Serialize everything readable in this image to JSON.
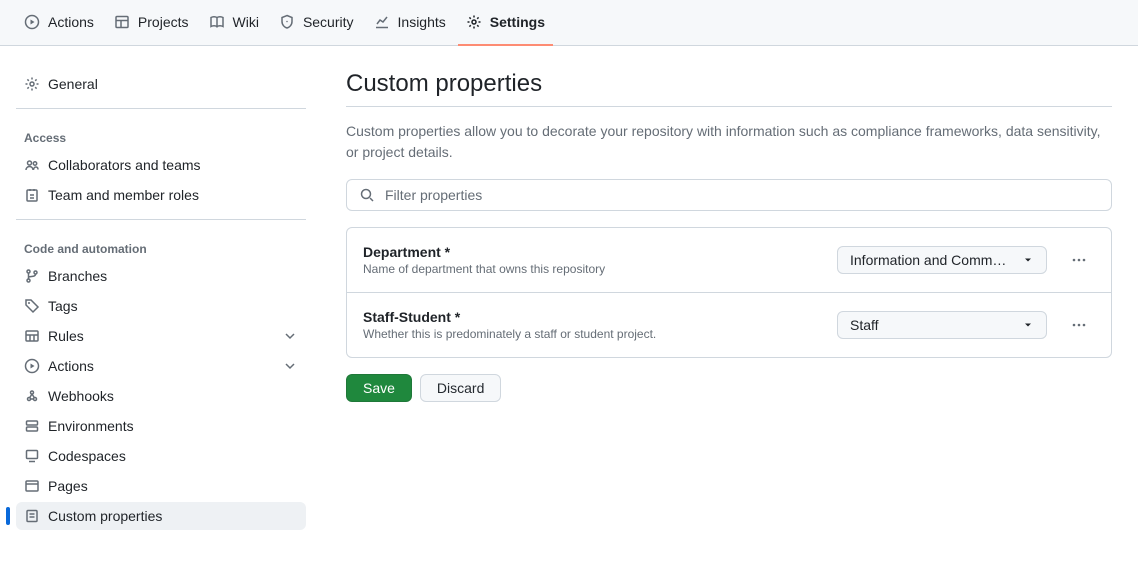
{
  "topnav": {
    "actions": "Actions",
    "projects": "Projects",
    "wiki": "Wiki",
    "security": "Security",
    "insights": "Insights",
    "settings": "Settings"
  },
  "sidebar": {
    "general": "General",
    "group_access": "Access",
    "collaborators": "Collaborators and teams",
    "team_roles": "Team and member roles",
    "group_code": "Code and automation",
    "branches": "Branches",
    "tags": "Tags",
    "rules": "Rules",
    "actions": "Actions",
    "webhooks": "Webhooks",
    "environments": "Environments",
    "codespaces": "Codespaces",
    "pages": "Pages",
    "custom_properties": "Custom properties"
  },
  "main": {
    "title": "Custom properties",
    "description": "Custom properties allow you to decorate your repository with information such as compliance frameworks, data sensitivity, or project details.",
    "search_placeholder": "Filter properties",
    "save": "Save",
    "discard": "Discard"
  },
  "properties": [
    {
      "label": "Department *",
      "sub": "Name of department that owns this repository",
      "value": "Information and Commu…"
    },
    {
      "label": "Staff-Student *",
      "sub": "Whether this is predominately a staff or student project.",
      "value": "Staff"
    }
  ]
}
